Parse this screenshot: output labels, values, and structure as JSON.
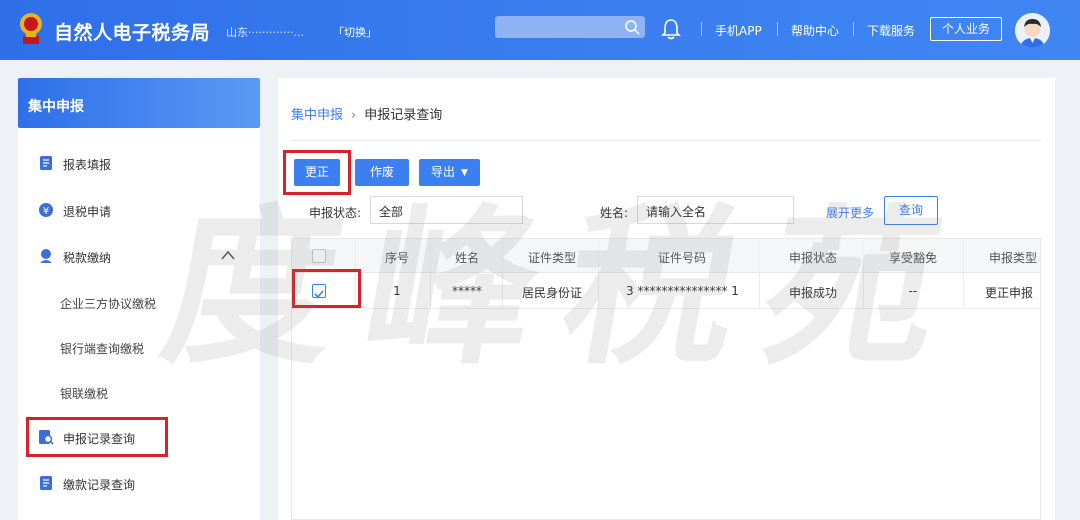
{
  "header": {
    "app_title": "自然人电子税务局",
    "region": "山东·············...",
    "switch_label": "「切换」",
    "links": [
      "手机APP",
      "帮助中心",
      "下载服务"
    ],
    "personal_button": "个人业务"
  },
  "sidebar": {
    "title": "集中申报",
    "items": [
      {
        "label": "报表填报",
        "icon": "document-icon"
      },
      {
        "label": "退税申请",
        "icon": "refund-icon"
      },
      {
        "label": "税款缴纳",
        "icon": "payment-icon"
      }
    ],
    "sub_items": [
      "企业三方协议缴税",
      "银行端查询缴税",
      "银联缴税"
    ],
    "items_after": [
      {
        "label": "申报记录查询",
        "icon": "record-search-icon"
      },
      {
        "label": "缴款记录查询",
        "icon": "document-icon"
      }
    ]
  },
  "breadcrumb": {
    "root": "集中申报",
    "current": "申报记录查询"
  },
  "toolbar": {
    "correct": "更正",
    "void": "作废",
    "export": "导出"
  },
  "filters": {
    "status_label": "申报状态:",
    "status_value": "全部",
    "name_label": "姓名:",
    "name_placeholder": "请输入全名",
    "expand_link": "展开更多",
    "query_button": "查询"
  },
  "table": {
    "columns": [
      "序号",
      "姓名",
      "证件类型",
      "证件号码",
      "申报状态",
      "享受豁免",
      "申报类型"
    ],
    "rows": [
      {
        "index": "1",
        "name": "*****",
        "id_type": "居民身份证",
        "id_number": "3 *************** 1",
        "status": "申报成功",
        "exempt": "--",
        "type": "更正申报"
      }
    ]
  },
  "watermark": "度峰税苑",
  "colors": {
    "primary": "#3b7ff0",
    "highlight": "#d6232a",
    "header": "#2f6fe9"
  }
}
